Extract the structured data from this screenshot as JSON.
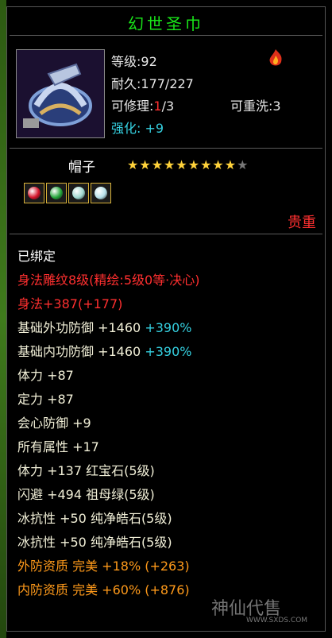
{
  "item": {
    "name": "幻世圣巾",
    "level": "等级:92",
    "durability": "耐久:177/227",
    "repair_prefix": "可修理:",
    "repair_count": "1",
    "repair_max": "/3",
    "reforge": "可重洗:3",
    "enhance_label": "强化:",
    "enhance_value": "+9",
    "type": "帽子",
    "stars_filled": 9,
    "stars_total": 10,
    "precious": "贵重"
  },
  "gems": [
    {
      "icon": "ruby-gem-icon",
      "color": "#d4142a"
    },
    {
      "icon": "emerald-gem-icon",
      "color": "#23a53a"
    },
    {
      "icon": "moonstone-gem-icon",
      "color": "#9fd8d0"
    },
    {
      "icon": "moonstone-gem-icon",
      "color": "#b7e1ea"
    }
  ],
  "attributes": [
    {
      "text": "已绑定",
      "extra": "",
      "style": "white"
    },
    {
      "text": "身法雕纹8级(精绘:5级0等·决心)",
      "extra": "",
      "style": "red"
    },
    {
      "text": "身法+387(+177)",
      "extra": "",
      "style": "red"
    },
    {
      "text": "基础外功防御 +1460 ",
      "extra": "+390%",
      "style": "normal"
    },
    {
      "text": "基础内功防御 +1460 ",
      "extra": "+390%",
      "style": "normal"
    },
    {
      "text": "体力 +87",
      "extra": "",
      "style": "normal"
    },
    {
      "text": "定力 +87",
      "extra": "",
      "style": "normal"
    },
    {
      "text": "会心防御 +9",
      "extra": "",
      "style": "normal"
    },
    {
      "text": "所有属性 +17",
      "extra": "",
      "style": "normal"
    },
    {
      "text": "体力 +137 红宝石(5级)",
      "extra": "",
      "style": "normal"
    },
    {
      "text": "闪避 +494 祖母绿(5级)",
      "extra": "",
      "style": "normal"
    },
    {
      "text": "冰抗性 +50 纯净皓石(5级)",
      "extra": "",
      "style": "normal"
    },
    {
      "text": "冰抗性 +50 纯净皓石(5级)",
      "extra": "",
      "style": "normal"
    },
    {
      "text": "外防资质  完美 +18% (+263)",
      "extra": "",
      "style": "orange"
    },
    {
      "text": "内防资质  完美 +60% (+876)",
      "extra": "",
      "style": "orange"
    }
  ],
  "watermark": {
    "text": "神仙代售",
    "url": "WWW.SXDS.COM"
  }
}
